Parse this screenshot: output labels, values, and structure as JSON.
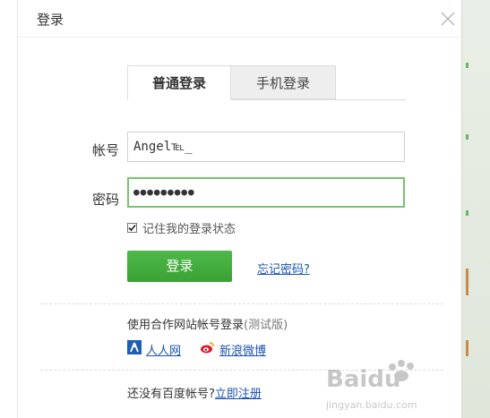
{
  "dialog": {
    "title": "登录"
  },
  "tabs": [
    {
      "label": "普通登录",
      "active": true
    },
    {
      "label": "手机登录",
      "active": false
    }
  ],
  "form": {
    "account_label": "帐号",
    "account_value": "Angel℡_",
    "password_label": "密码",
    "password_value": "●●●●●●●●●",
    "remember_label": "记住我的登录状态",
    "remember_checked": true,
    "login_button": "登录",
    "forgot_link": "忘记密码?"
  },
  "partners": {
    "title": "使用合作网站帐号登录",
    "title_hint": "(测试版)",
    "items": [
      {
        "label": "人人网",
        "icon": "renren-icon"
      },
      {
        "label": "新浪微博",
        "icon": "weibo-icon"
      }
    ]
  },
  "register": {
    "prompt": "还没有百度帐号?",
    "link": "立即注册"
  },
  "watermark": {
    "brand": "Baidu",
    "url": "jingyan.baidu.com"
  },
  "colors": {
    "accent_green": "#3aa234",
    "focus_border": "#77c46e",
    "link_blue": "#1a52b3"
  }
}
